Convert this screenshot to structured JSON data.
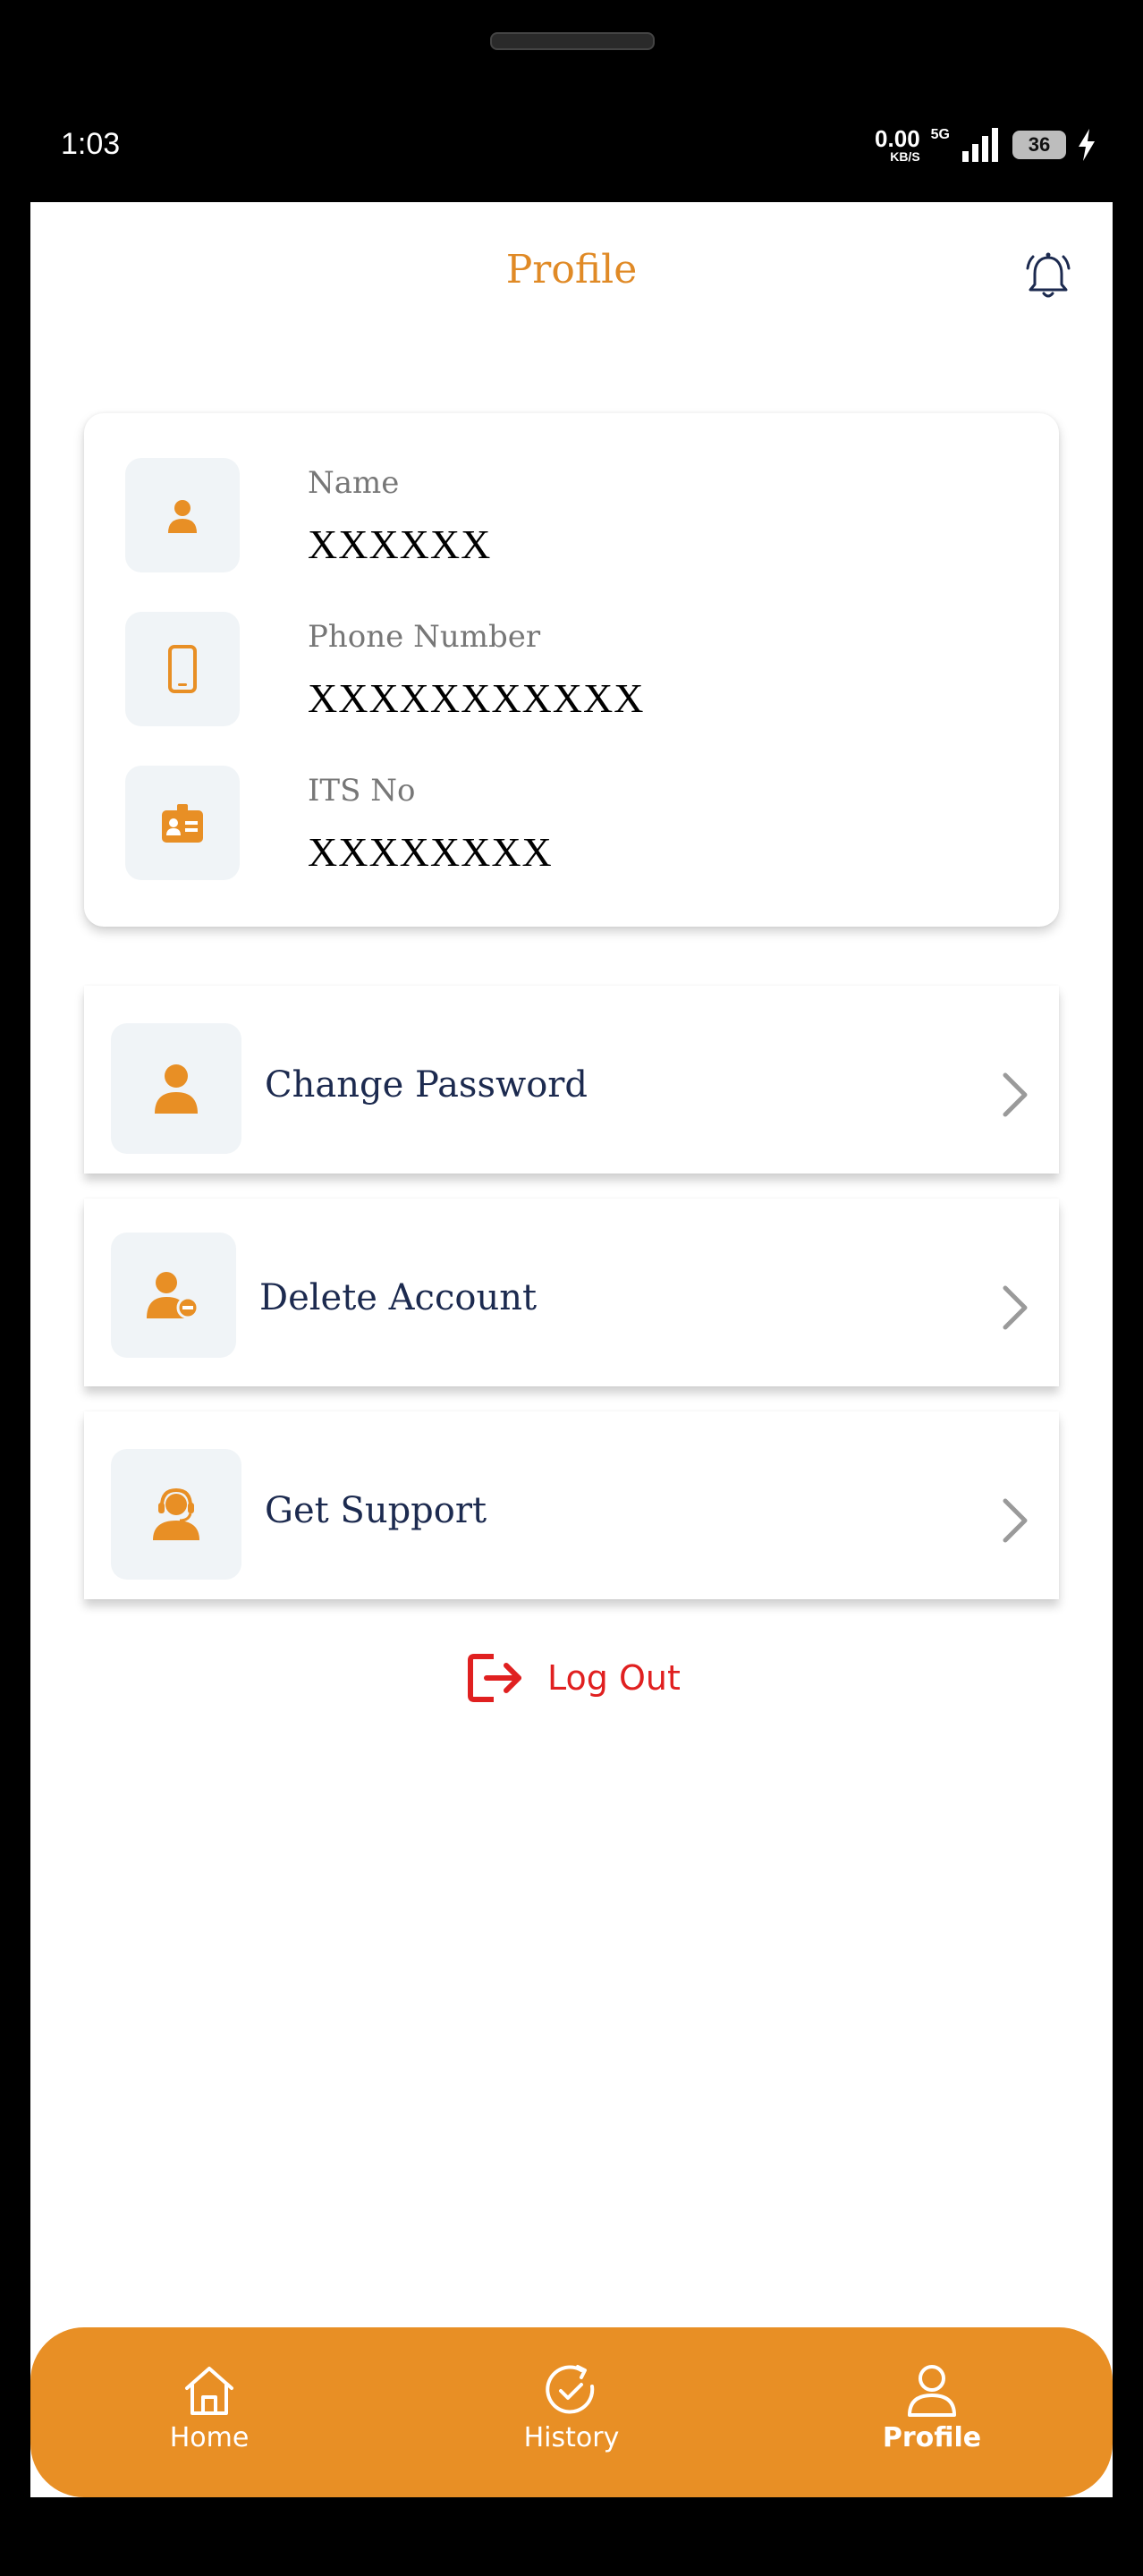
{
  "status_bar": {
    "time": "1:03",
    "net_speed_value": "0.00",
    "net_speed_unit": "KB/S",
    "network_type": "5G",
    "battery": "36"
  },
  "header": {
    "title": "Profile",
    "notification_icon": "bell-icon"
  },
  "profile_info": {
    "name_label": "Name",
    "name_value": "XXXXXX",
    "phone_label": "Phone Number",
    "phone_value": "XXXXXXXXXXX",
    "its_label": "ITS No",
    "its_value": "XXXXXXXX"
  },
  "menu": [
    {
      "label": "Change Password",
      "icon": "user-icon"
    },
    {
      "label": "Delete Account",
      "icon": "user-remove-icon"
    },
    {
      "label": "Get Support",
      "icon": "support-agent-icon"
    }
  ],
  "logout": {
    "label": "Log Out",
    "icon": "logout-icon"
  },
  "bottom_nav": [
    {
      "label": "Home",
      "icon": "home-icon",
      "active": false
    },
    {
      "label": "History",
      "icon": "history-icon",
      "active": false
    },
    {
      "label": "Profile",
      "icon": "profile-icon",
      "active": true
    }
  ],
  "colors": {
    "accent": "#E88F25",
    "title": "#E08A26",
    "menu_text": "#1C2A4F",
    "logout": "#E02020",
    "icon_bg": "#F0F4F7"
  }
}
